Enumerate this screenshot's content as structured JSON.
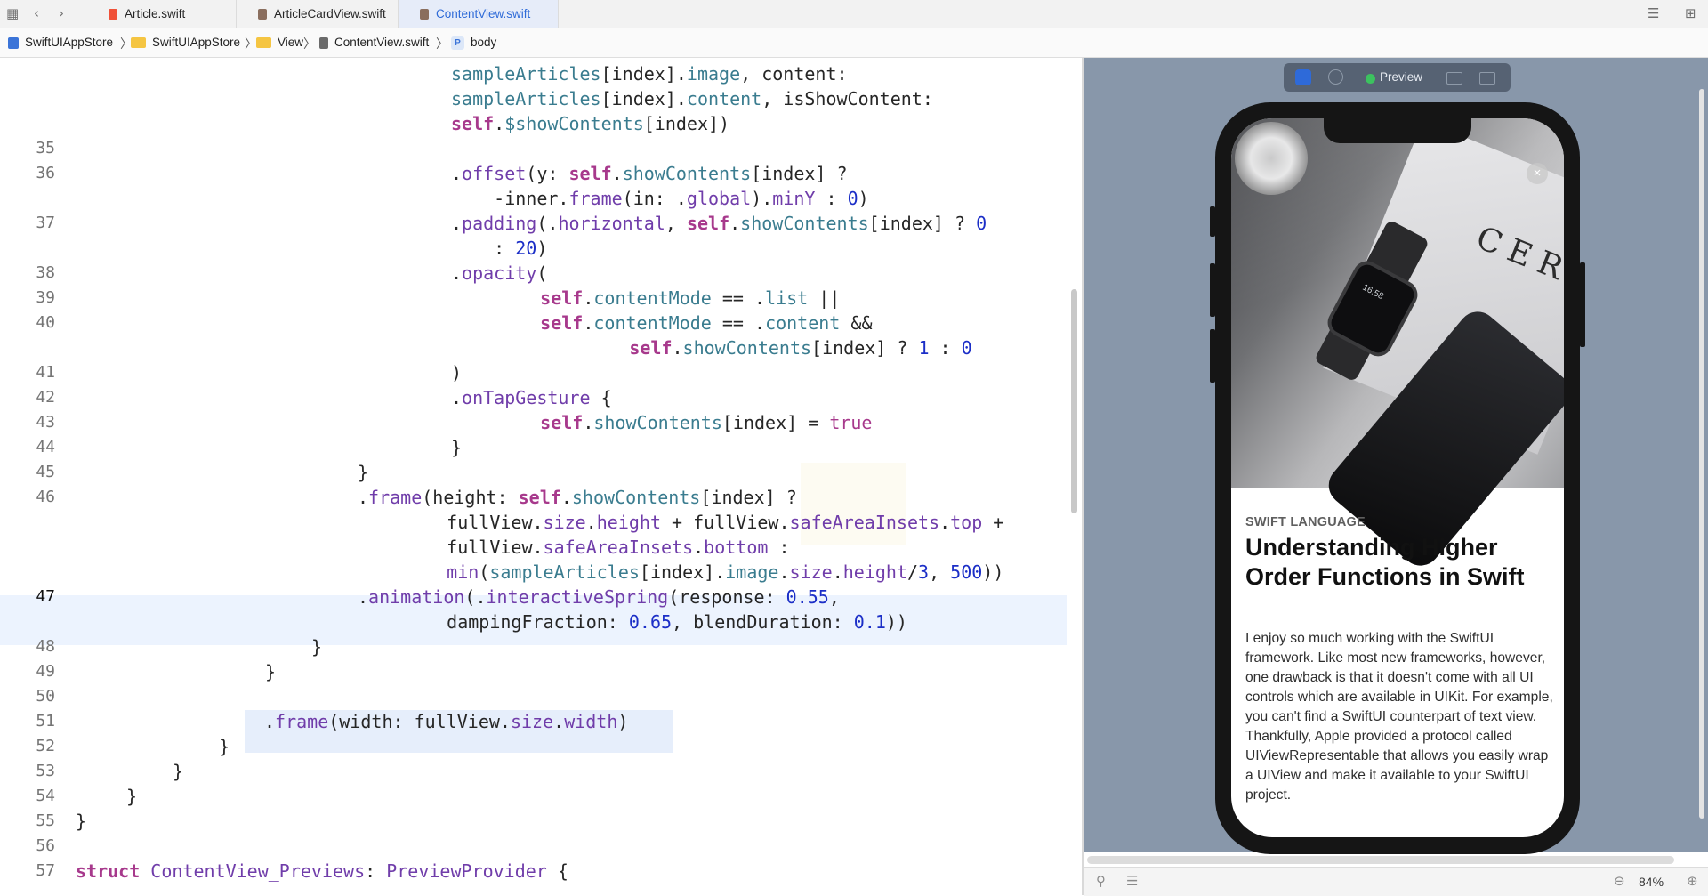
{
  "tabs": [
    {
      "label": "Article.swift",
      "active": false
    },
    {
      "label": "ArticleCardView.swift",
      "active": false
    },
    {
      "label": "ContentView.swift",
      "active": true
    }
  ],
  "breadcrumb": [
    "SwiftUIAppStore",
    "SwiftUIAppStore",
    "View",
    "ContentView.swift",
    "body"
  ],
  "editor": {
    "current_line": "47",
    "lines": [
      {
        "num": "",
        "html": "<span class=\"p\">sampleArticles</span>[index].<span class=\"p\">image</span>, content:"
      },
      {
        "num": "",
        "html": "<span class=\"p\">sampleArticles</span>[index].<span class=\"p\">content</span>, isShowContent:"
      },
      {
        "num": "",
        "html": "<span class=\"k\">self</span>.<span class=\"p\">$showContents</span>[index])"
      },
      {
        "num": "35",
        "html": ""
      },
      {
        "num": "36",
        "html": ".<span class=\"t\">offset</span>(y: <span class=\"k\">self</span>.<span class=\"p\">showContents</span>[index] ?"
      },
      {
        "num": "",
        "html": "    -inner.<span class=\"t\">frame</span>(in: .<span class=\"t\">global</span>).<span class=\"t\">minY</span> : <span class=\"n\">0</span>)"
      },
      {
        "num": "37",
        "html": ".<span class=\"t\">padding</span>(.<span class=\"t\">horizontal</span>, <span class=\"k\">self</span>.<span class=\"p\">showContents</span>[index] ? <span class=\"n\">0</span>"
      },
      {
        "num": "",
        "html": "    : <span class=\"n\">20</span>)"
      },
      {
        "num": "38",
        "html": ".<span class=\"t\">opacity</span>("
      },
      {
        "num": "39",
        "html": "    <span class=\"k\">self</span>.<span class=\"p\">contentMode</span> == .<span class=\"p\">list</span> ||"
      },
      {
        "num": "40",
        "html": "    <span class=\"k\">self</span>.<span class=\"p\">contentMode</span> == .<span class=\"p\">content</span> &&"
      },
      {
        "num": "",
        "html": "        <span class=\"k\">self</span>.<span class=\"p\">showContents</span>[index] ? <span class=\"n\">1</span> : <span class=\"n\">0</span>"
      },
      {
        "num": "41",
        "html": ")"
      },
      {
        "num": "42",
        "html": ".<span class=\"t\">onTapGesture</span> {"
      },
      {
        "num": "43",
        "html": "    <span class=\"k\">self</span>.<span class=\"p\">showContents</span>[index] = <span class=\"tv\">true</span>"
      },
      {
        "num": "44",
        "html": "}"
      },
      {
        "num": "45",
        "html": "}"
      },
      {
        "num": "46",
        "html": ".<span class=\"t\">frame</span>(height: <span class=\"k\">self</span>.<span class=\"p\">showContents</span>[index] ?"
      },
      {
        "num": "",
        "html": "    fullView.<span class=\"t\">size</span>.<span class=\"t\">height</span> + fullView.<span class=\"t\">safeAreaInsets</span>.<span class=\"t\">top</span> +"
      },
      {
        "num": "",
        "html": "    fullView.<span class=\"t\">safeAreaInsets</span>.<span class=\"t\">bottom</span> :"
      },
      {
        "num": "",
        "html": "    <span class=\"t\">min</span>(<span class=\"p\">sampleArticles</span>[index].<span class=\"p\">image</span>.<span class=\"t\">size</span>.<span class=\"t\">height</span>/<span class=\"n\">3</span>, <span class=\"n\">500</span>))"
      },
      {
        "num": "47",
        "html": ".<span class=\"t\">animation</span>(.<span class=\"t\">interactiveSpring</span>(response: <span class=\"n\">0.55</span>,"
      },
      {
        "num": "",
        "html": "    dampingFraction: <span class=\"n\">0.65</span>, blendDuration: <span class=\"n\">0.1</span>))"
      },
      {
        "num": "48",
        "html": "}"
      },
      {
        "num": "49",
        "html": "}"
      },
      {
        "num": "50",
        "html": ""
      },
      {
        "num": "51",
        "html": ".<span class=\"t\">frame</span>(width: fullView.<span class=\"t\">size</span>.<span class=\"t\">width</span>)"
      },
      {
        "num": "52",
        "html": "}"
      },
      {
        "num": "53",
        "html": "}"
      },
      {
        "num": "54",
        "html": "}"
      },
      {
        "num": "55",
        "html": "}"
      },
      {
        "num": "56",
        "html": ""
      },
      {
        "num": "57",
        "html": "<span class=\"k\">struct</span> <span class=\"t\">ContentView_Previews</span>: <span class=\"t\">PreviewProvider</span> {"
      }
    ]
  },
  "preview": {
    "toolbar_label": "Preview",
    "photo_text": "CERE",
    "watch_time": "16:58",
    "close_glyph": "×",
    "category": "SWIFT LANGUAGE",
    "headline": "Understanding Higher Order Functions in Swift",
    "body": "I enjoy so much working with the SwiftUI framework. Like most new frameworks, however, one drawback is that it doesn't come with all UI controls which are available in UIKit. For example, you can't find a SwiftUI counterpart of text view. Thankfully, Apple provided a protocol called UIViewRepresentable that allows you easily wrap a UIView and make it available to your SwiftUI project."
  },
  "status": {
    "zoom": "84%"
  },
  "icons": {
    "grid": "grid-icon",
    "back": "back-icon",
    "forward": "forward-icon",
    "pin": "pin-icon",
    "zoom_out": "zoom-out-icon",
    "zoom_in": "zoom-in-icon"
  },
  "colors": {
    "accent": "#2f6bd8",
    "keyword": "#a7398c",
    "number": "#1b2ec7",
    "preview_bg": "#8897aa"
  }
}
